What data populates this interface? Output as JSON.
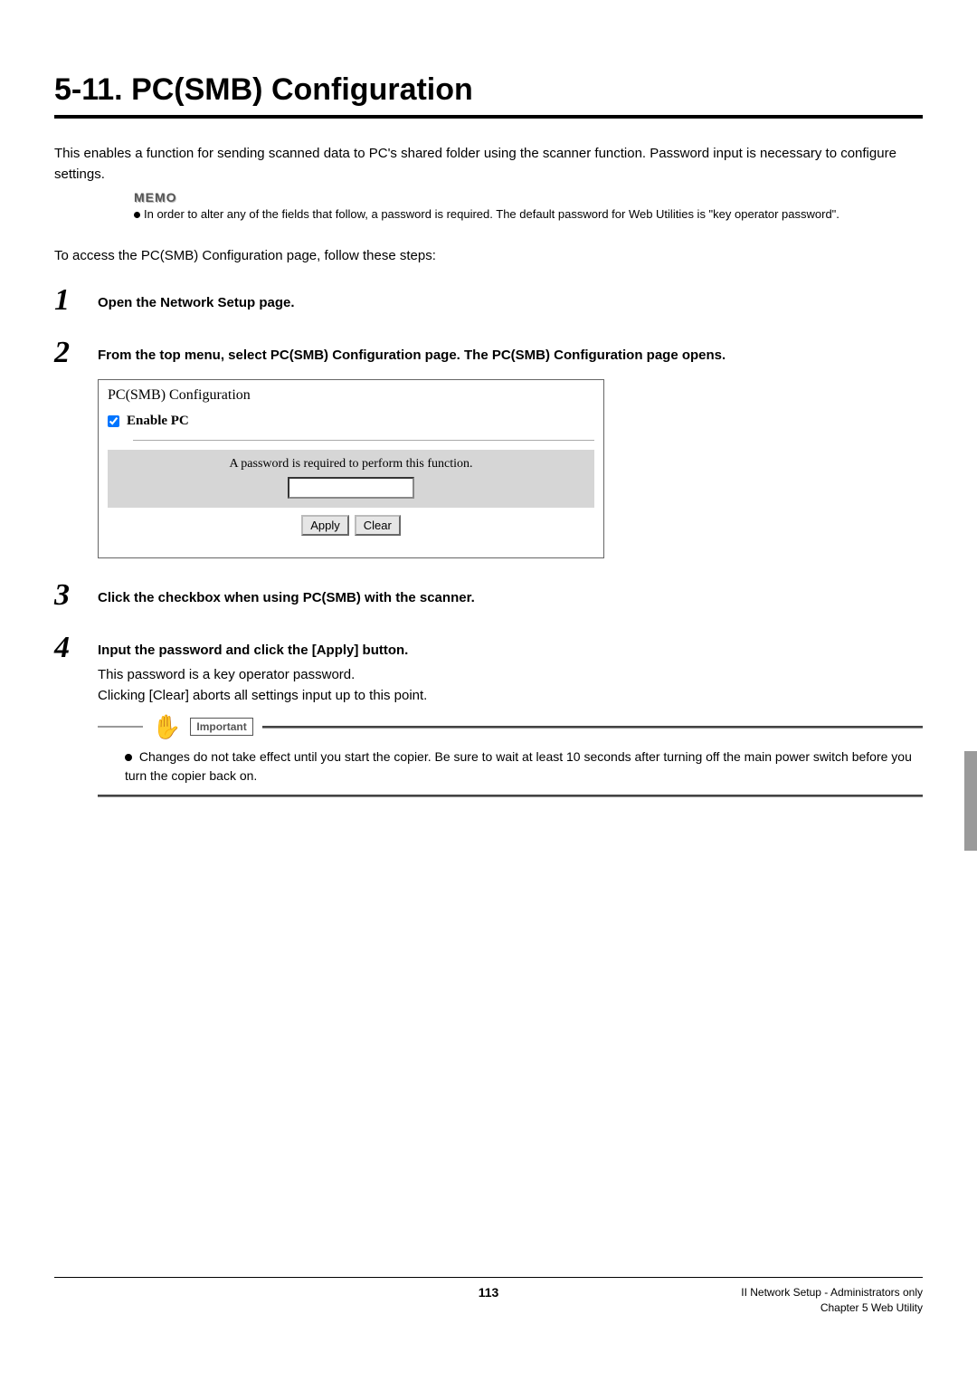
{
  "title": "5-11. PC(SMB) Configuration",
  "intro": "This enables a function for sending scanned data to PC's shared folder using the scanner function. Password input is necessary to configure settings.",
  "memo": {
    "label": "MEMO",
    "text": "In order to alter any of the fields that follow, a password is required. The default password for Web Utilities is \"key operator password\"."
  },
  "access_line": "To access the PC(SMB) Configuration page, follow these steps:",
  "steps": {
    "s1": {
      "num": "1",
      "bold": "Open the Network Setup page."
    },
    "s2": {
      "num": "2",
      "bold": "From the top menu, select PC(SMB) Configuration page. The PC(SMB) Configuration page opens."
    },
    "s3": {
      "num": "3",
      "bold": "Click the checkbox when using PC(SMB) with the scanner."
    },
    "s4": {
      "num": "4",
      "bold": "Input the password and click the [Apply] button.",
      "plain1": "This password is a key operator password.",
      "plain2": "Clicking [Clear] aborts all settings input up to this point."
    }
  },
  "screenshot": {
    "title": "PC(SMB) Configuration",
    "enable_label": "Enable PC",
    "password_msg": "A password is required to perform this function.",
    "apply": "Apply",
    "clear": "Clear"
  },
  "important": {
    "label": "Important",
    "text": "Changes do not take effect until you start the copier. Be sure to wait at least 10 seconds after turning off the main power switch before you turn the copier back on."
  },
  "footer": {
    "page": "113",
    "right1": "II Network Setup - Administrators only",
    "right2": "Chapter 5 Web Utility"
  }
}
